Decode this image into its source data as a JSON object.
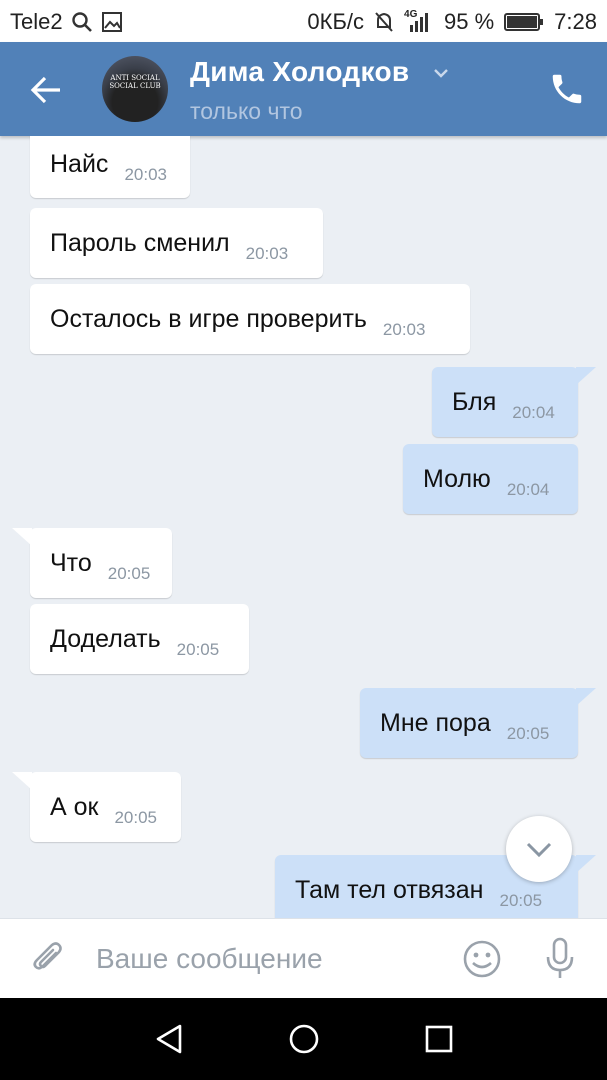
{
  "status_bar": {
    "carrier": "Tele2",
    "speed": "0КБ/с",
    "network": "4G",
    "battery": "95 %",
    "time": "7:28",
    "icons": [
      "search-icon",
      "image-icon",
      "mute-icon",
      "signal-icon",
      "battery-icon"
    ]
  },
  "header": {
    "contact_name": "Дима Холодков",
    "status": "только что",
    "avatar_text": "ANTI SOCIAL SOCIAL CLUB"
  },
  "messages": [
    {
      "dir": "in",
      "text": "Найс",
      "time": "20:03"
    },
    {
      "dir": "in",
      "text": "Пароль сменил",
      "time": "20:03"
    },
    {
      "dir": "in",
      "text": "Осталось в игре проверить",
      "time": "20:03"
    },
    {
      "dir": "out",
      "text": "Бля",
      "time": "20:04"
    },
    {
      "dir": "out",
      "text": "Молю",
      "time": "20:04"
    },
    {
      "dir": "in",
      "text": "Что",
      "time": "20:05"
    },
    {
      "dir": "in",
      "text": "Доделать",
      "time": "20:05"
    },
    {
      "dir": "out",
      "text": "Мне пора",
      "time": "20:05"
    },
    {
      "dir": "in",
      "text": "А ок",
      "time": "20:05"
    },
    {
      "dir": "out",
      "text": "Там тел отвязан",
      "time": "20:05"
    }
  ],
  "composer": {
    "placeholder": "Ваше сообщение",
    "value": ""
  },
  "colors": {
    "header": "#5181b8",
    "incoming_bubble": "#ffffff",
    "outgoing_bubble": "#cce0f8",
    "background": "#ebeff4"
  }
}
